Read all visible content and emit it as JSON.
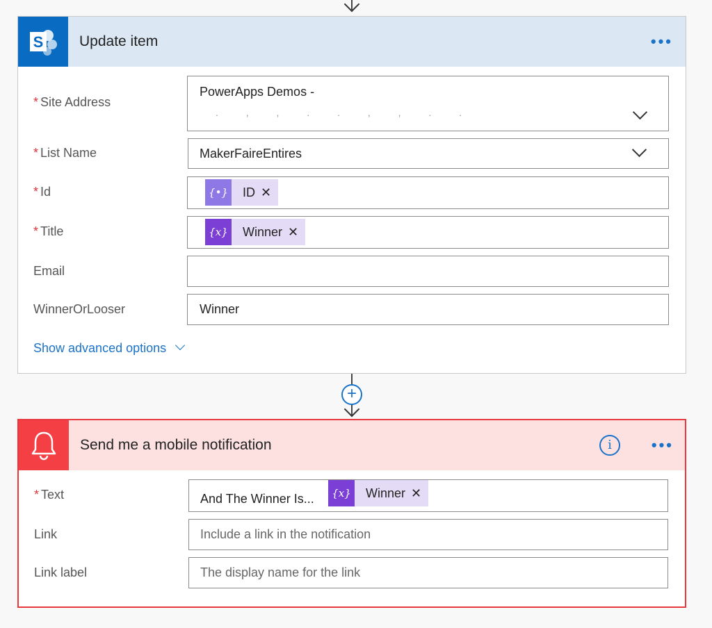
{
  "update_item": {
    "title": "Update item",
    "more_label": "•••",
    "site_address": {
      "label": "Site Address",
      "value_line1": "PowerApps Demos -",
      "value_line2": ". , , . . , , . ."
    },
    "list_name": {
      "label": "List Name",
      "value": "MakerFaireEntires"
    },
    "id": {
      "label": "Id",
      "token_icon": "{•}",
      "token_label": "ID"
    },
    "title_field": {
      "label": "Title",
      "token_icon": "{x}",
      "token_label": "Winner"
    },
    "email": {
      "label": "Email",
      "value": ""
    },
    "winner_or_looser": {
      "label": "WinnerOrLooser",
      "value": "Winner"
    },
    "advanced_options": "Show advanced options"
  },
  "connector": {
    "add_label": "+"
  },
  "notification": {
    "title": "Send me a mobile notification",
    "info_label": "i",
    "more_label": "•••",
    "text": {
      "label": "Text",
      "prefix": "And The Winner Is...",
      "token_icon": "{x}",
      "token_label": "Winner"
    },
    "link": {
      "label": "Link",
      "placeholder": "Include a link in the notification"
    },
    "link_label": {
      "label": "Link label",
      "placeholder": "The display name for the link"
    }
  },
  "required_marker": "*",
  "remove_glyph": "✕",
  "colors": {
    "sharepoint_blue": "#0a6bc2",
    "notification_red": "#f43f44",
    "link_blue": "#1b72c9",
    "token_bg": "#e4dcf7",
    "token_icon_purple": "#7b3fd6",
    "token_icon_light": "#8d78e6"
  }
}
